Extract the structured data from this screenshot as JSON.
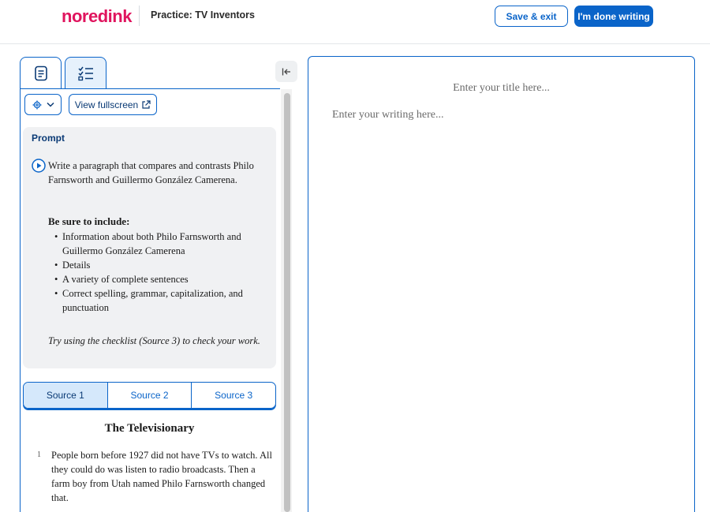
{
  "header": {
    "logo": {
      "no": "no",
      "red": "red",
      "ink": "ink"
    },
    "title": "Practice: TV Inventors",
    "save_exit_label": "Save & exit",
    "done_label": "I'm done writing"
  },
  "left_panel": {
    "tabs": [
      {
        "icon": "document-icon",
        "active": false
      },
      {
        "icon": "checklist-icon",
        "active": true
      }
    ],
    "collapse_icon": "collapse-left-icon",
    "settings_icon": "gear-icon",
    "fullscreen_label": "View fullscreen",
    "prompt": {
      "label": "Prompt",
      "text": "Write a paragraph that compares and contrasts Philo Farnsworth and Guillermo González Camerena.",
      "include_title": "Be sure to include:",
      "bullets": [
        "Information about both Philo Farnsworth and Guillermo González Camerena",
        "Details",
        "A variety of complete sentences",
        "Correct spelling, grammar, capitalization, and punctuation"
      ],
      "try_text": "Try using the checklist (Source 3) to check your work."
    },
    "source_tabs": [
      "Source 1",
      "Source 2",
      "Source 3"
    ],
    "active_source": 0,
    "article": {
      "title": "The Televisionary",
      "paragraph_number": "1",
      "paragraph": "People born before 1927 did not have TVs to watch. All they could do was listen to radio broadcasts. Then a farm boy from Utah named Philo Farnsworth changed that."
    }
  },
  "editor": {
    "title_placeholder": "Enter your title here...",
    "body_placeholder": "Enter your writing here..."
  },
  "colors": {
    "brand": "#e0145e",
    "accent": "#0a64c9",
    "prompt_bg": "#f0f1f3",
    "active_tab_bg": "#d5e8fb"
  }
}
